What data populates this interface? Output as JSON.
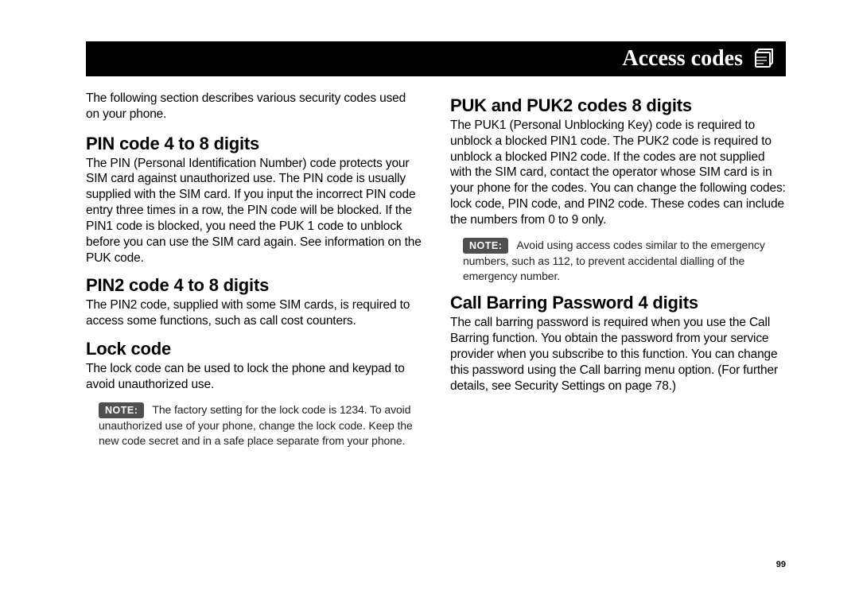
{
  "header": {
    "title": "Access codes"
  },
  "left": {
    "intro": "The following section describes various security codes used on your phone.",
    "section1": {
      "heading": "PIN code 4 to 8 digits",
      "body": "The PIN (Personal Identification Number) code protects your SIM card against unauthorized use. The PIN code is usually supplied with the SIM card. If you input the incorrect PIN code entry three times in a row, the PIN code will be blocked. If the PIN1 code is blocked, you need the PUK 1 code to unblock before you can use the SIM card again. See information on the PUK code."
    },
    "section2": {
      "heading": "PIN2 code 4 to 8 digits",
      "body": "The PIN2 code, supplied with some SIM cards, is required to access some functions, such as call cost counters."
    },
    "section3": {
      "heading": "Lock code",
      "body": "The lock code can be used to lock the phone and keypad to avoid unauthorized use.",
      "note_label": "NOTE:",
      "note": "The factory setting for the lock code is 1234. To avoid unauthorized use of your phone, change the lock code. Keep the new code secret and in a safe place separate from your phone."
    }
  },
  "right": {
    "section1": {
      "heading": "PUK and PUK2 codes 8 digits",
      "body": "The PUK1 (Personal Unblocking Key) code is required to unblock a blocked PIN1 code. The PUK2 code is required to unblock a blocked PIN2 code. If the codes are not supplied with the SIM card, contact the operator whose SIM card is in your phone for the codes. You can change the following codes: lock code, PIN code, and PIN2 code. These codes can include the numbers from 0 to 9 only.",
      "note_label": "NOTE:",
      "note": "Avoid using access codes similar to the emergency numbers, such as 112, to prevent accidental dialling of the emergency number."
    },
    "section2": {
      "heading": "Call Barring Password 4 digits",
      "body": "The call barring password is required when you use the Call Barring function. You obtain the password from your service provider when you subscribe to this function. You can change this password using the Call barring menu option. (For further details, see Security Settings on page 78.)"
    }
  },
  "page_number": "99"
}
